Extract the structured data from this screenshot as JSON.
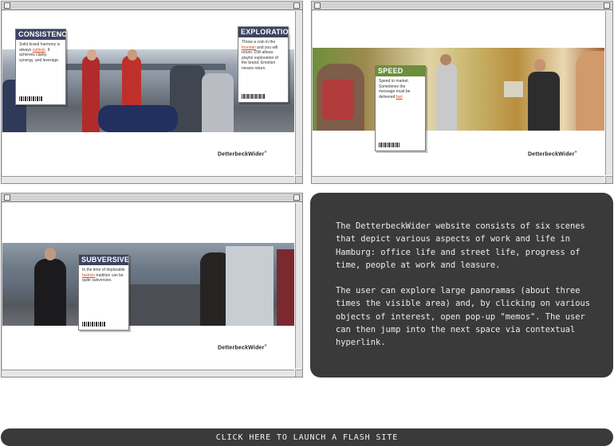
{
  "brand_logo": "DetterbeckWider",
  "brand_logo_mark": "®",
  "windows": [
    {
      "memos": [
        {
          "title": "CONSISTENCY",
          "text_before": "Solid brand harmony is always ",
          "link": "outlook",
          "text_after": ". It achieves clarity, synergy, and leverage.",
          "color": "#3d4463"
        },
        {
          "title": "EXPLORATION",
          "text_before": "Throw a coin in the ",
          "link": "fountain",
          "text_after": " and you will return. DW allows playful exploration of the brand. Emotion means return.",
          "color": "#3d4463"
        }
      ]
    },
    {
      "memos": [
        {
          "title": "SPEED",
          "text_before": "Speed to market. Sometimes the message must be delivered ",
          "link": "fast",
          "text_after": "",
          "color": "#6b8f3a"
        }
      ]
    },
    {
      "memos": [
        {
          "title": "SUBVERSIVE",
          "text_before": "In the time of deplorable ",
          "link": "fashion",
          "text_after": " tradition can be quite subversive.",
          "color": "#3d4463"
        }
      ]
    }
  ],
  "description": {
    "paragraph_1": "The DetterbeckWider website consists of six scenes that depict various aspects of work and life in Hamburg: office life and street life, progress of time, people at work and leasure.",
    "paragraph_2": "The user can explore large panoramas (about three times the visible area) and, by clicking on various objects of interest, open pop-up \"memos\". The user can then jump into the next space via contextual hyperlink."
  },
  "launch_button": "CLICK HERE TO LAUNCH A FLASH SITE",
  "colors": {
    "panel_bg": "#3a3a3a",
    "memo_blue": "#3d4463",
    "memo_green": "#6b8f3a",
    "link_orange": "#d04a1f"
  }
}
